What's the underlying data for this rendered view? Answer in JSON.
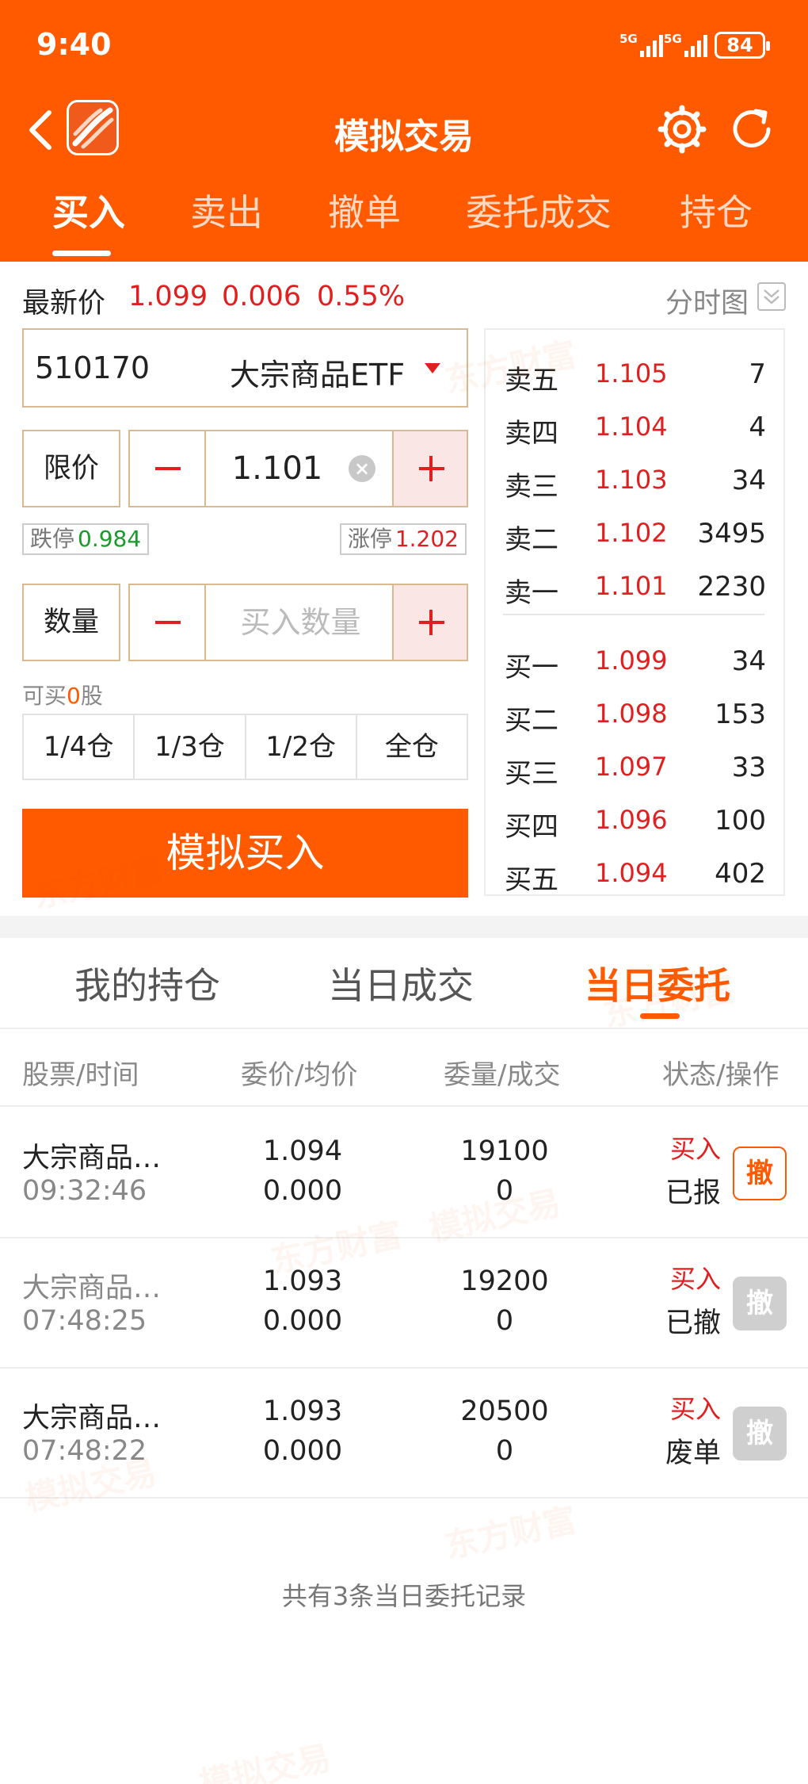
{
  "status_bar": {
    "time": "9:40",
    "signal1": "5G",
    "signal2": "5G",
    "battery": "84"
  },
  "nav": {
    "title": "模拟交易"
  },
  "tabs": [
    "买入",
    "卖出",
    "撤单",
    "委托成交",
    "持仓"
  ],
  "quote": {
    "label": "最新价",
    "price": "1.099",
    "change": "0.006",
    "pct": "0.55%",
    "chart_label": "分时图"
  },
  "stock": {
    "code": "510170",
    "name": "大宗商品ETF"
  },
  "price_input": {
    "label": "限价",
    "value": "1.101"
  },
  "limits": {
    "down_label": "跌停",
    "down_value": "0.984",
    "up_label": "涨停",
    "up_value": "1.202"
  },
  "qty_input": {
    "label": "数量",
    "placeholder": "买入数量"
  },
  "available": {
    "prefix": "可买",
    "count": "0",
    "suffix": "股"
  },
  "positions": [
    "1/4仓",
    "1/3仓",
    "1/2仓",
    "全仓"
  ],
  "buy_button": "模拟买入",
  "order_book": {
    "sell": [
      {
        "label": "卖五",
        "price": "1.105",
        "vol": "7"
      },
      {
        "label": "卖四",
        "price": "1.104",
        "vol": "4"
      },
      {
        "label": "卖三",
        "price": "1.103",
        "vol": "34"
      },
      {
        "label": "卖二",
        "price": "1.102",
        "vol": "3495"
      },
      {
        "label": "卖一",
        "price": "1.101",
        "vol": "2230"
      }
    ],
    "buy": [
      {
        "label": "买一",
        "price": "1.099",
        "vol": "34"
      },
      {
        "label": "买二",
        "price": "1.098",
        "vol": "153"
      },
      {
        "label": "买三",
        "price": "1.097",
        "vol": "33"
      },
      {
        "label": "买四",
        "price": "1.096",
        "vol": "100"
      },
      {
        "label": "买五",
        "price": "1.094",
        "vol": "402"
      }
    ]
  },
  "bottom_tabs": [
    "我的持仓",
    "当日成交",
    "当日委托"
  ],
  "table": {
    "headers": [
      "股票/时间",
      "委价/均价",
      "委量/成交",
      "状态/操作"
    ],
    "rows": [
      {
        "name": "大宗商品…",
        "time": "09:32:46",
        "price": "1.094",
        "avg": "0.000",
        "qty": "19100",
        "filled": "0",
        "type": "买入",
        "status": "已报",
        "cancel": "撤"
      },
      {
        "name": "大宗商品…",
        "time": "07:48:25",
        "price": "1.093",
        "avg": "0.000",
        "qty": "19200",
        "filled": "0",
        "type": "买入",
        "status": "已撤",
        "cancel": "撤"
      },
      {
        "name": "大宗商品…",
        "time": "07:48:22",
        "price": "1.093",
        "avg": "0.000",
        "qty": "20500",
        "filled": "0",
        "type": "买入",
        "status": "废单",
        "cancel": "撤"
      }
    ]
  },
  "footer": "共有3条当日委托记录",
  "watermark": {
    "brand": "东方财富",
    "tag": "模拟交易"
  },
  "colors": {
    "brand": "#ff5a00",
    "up": "#e02020",
    "down": "#1a9a2a"
  }
}
